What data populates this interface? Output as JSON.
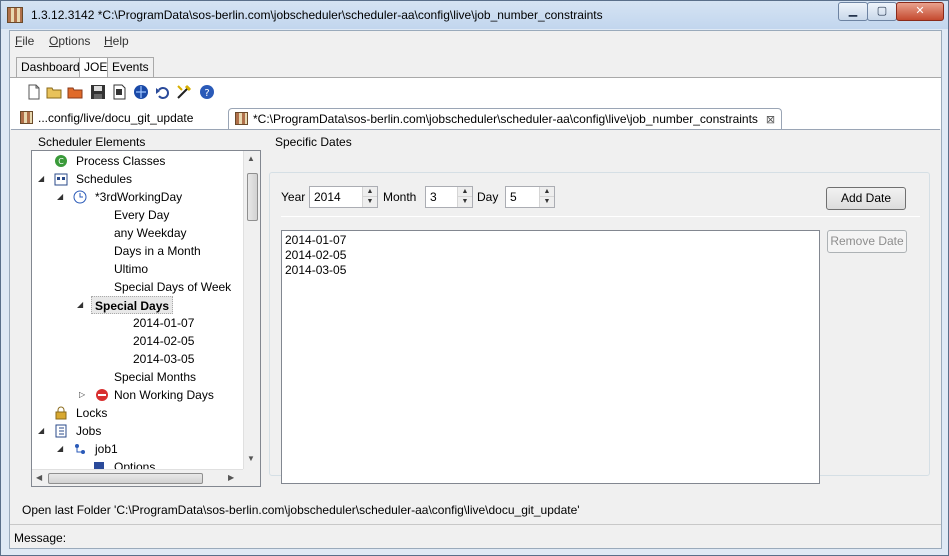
{
  "window": {
    "title": "1.3.12.3142 *C:\\ProgramData\\sos-berlin.com\\jobscheduler\\scheduler-aa\\config\\live\\job_number_constraints",
    "min_icon": "minimize-icon",
    "max_icon": "maximize-icon",
    "close_icon": "close-icon"
  },
  "menu": [
    {
      "accel": "F",
      "rest": "ile"
    },
    {
      "accel": "O",
      "rest": "ptions"
    },
    {
      "accel": "H",
      "rest": "elp"
    }
  ],
  "outer_tabs": [
    "Dashboard",
    "JOE",
    "Events"
  ],
  "toolbar_icons": [
    "new-file-icon",
    "open-folder-icon",
    "open-remote-folder-icon",
    "save-icon",
    "save-as-icon",
    "web-service-icon",
    "undo-icon",
    "tool-icon",
    "help-icon"
  ],
  "editor_tabs": [
    {
      "label": "...config/live/docu_git_update"
    },
    {
      "label": "*C:\\ProgramData\\sos-berlin.com\\jobscheduler\\scheduler-aa\\config\\live\\job_number_constraints",
      "close": "⊠"
    }
  ],
  "tree": {
    "title": "Scheduler Elements",
    "items": [
      {
        "label": "Process Classes",
        "icon": "process-class-icon"
      },
      {
        "label": "Schedules",
        "icon": "schedules-icon"
      },
      {
        "label": "*3rdWorkingDay",
        "icon": "schedule-icon"
      },
      {
        "label": "Every Day"
      },
      {
        "label": "any Weekday"
      },
      {
        "label": "Days in a Month"
      },
      {
        "label": "Ultimo"
      },
      {
        "label": "Special Days of Week"
      },
      {
        "label": "Special Days"
      },
      {
        "label": "2014-01-07"
      },
      {
        "label": "2014-02-05"
      },
      {
        "label": "2014-03-05"
      },
      {
        "label": "Special Months"
      },
      {
        "label": "Non Working Days",
        "icon": "stop-icon"
      },
      {
        "label": "Locks",
        "icon": "lock-icon"
      },
      {
        "label": "Jobs",
        "icon": "jobs-icon"
      },
      {
        "label": "job1",
        "icon": "job-icon"
      },
      {
        "label": "Options",
        "icon": "options-icon"
      }
    ]
  },
  "specific_dates": {
    "title": "Specific Dates",
    "year_label": "Year",
    "year_value": "2014",
    "month_label": "Month",
    "month_value": "3",
    "day_label": "Day",
    "day_value": "5",
    "add_button": "Add Date",
    "remove_button": "Remove Date",
    "dates": [
      "2014-01-07",
      "2014-02-05",
      "2014-03-05"
    ]
  },
  "status": {
    "info": "Open last Folder 'C:\\ProgramData\\sos-berlin.com\\jobscheduler\\scheduler-aa\\config\\live\\docu_git_update'",
    "message_label": "Message:"
  }
}
